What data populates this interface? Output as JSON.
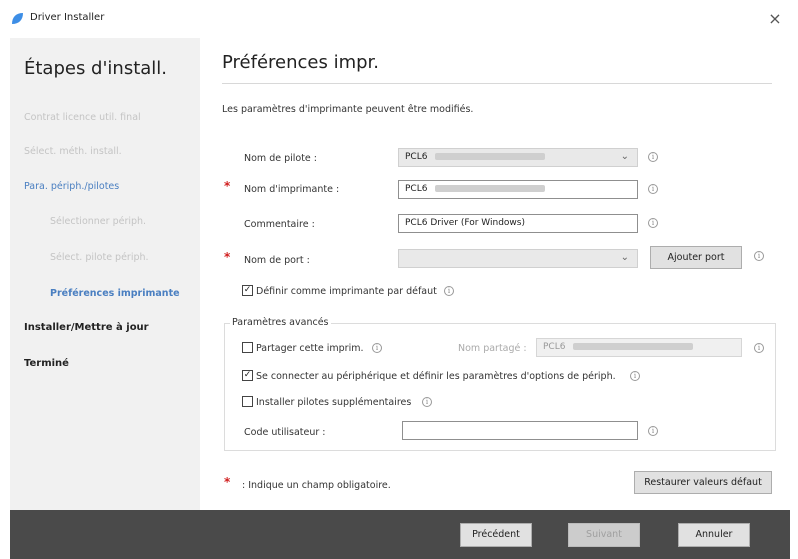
{
  "window": {
    "title": "Driver Installer",
    "close": "×"
  },
  "sidebar": {
    "heading": "Étapes d'install.",
    "steps": [
      {
        "label": "Contrat licence util. final",
        "state": "done"
      },
      {
        "label": "Sélect. méth. install.",
        "state": "done"
      },
      {
        "label": "Para. périph./pilotes",
        "state": "current-parent"
      },
      {
        "label": "Sélectionner périph.",
        "state": "done-sub"
      },
      {
        "label": "Sélect. pilote périph.",
        "state": "done-sub"
      },
      {
        "label": "Préférences imprimante",
        "state": "current"
      },
      {
        "label": "Installer/Mettre à jour",
        "state": "pending"
      },
      {
        "label": "Terminé",
        "state": "pending"
      }
    ]
  },
  "main": {
    "heading": "Préférences impr.",
    "description": "Les paramètres d'imprimante peuvent être modifiés.",
    "driver_name": {
      "label": "Nom de pilote :",
      "value": "PCL6"
    },
    "printer_name": {
      "label": "Nom d'imprimante :",
      "value": "PCL6"
    },
    "comment": {
      "label": "Commentaire :",
      "value": "PCL6 Driver (For Windows)"
    },
    "port_name": {
      "label": "Nom de port :",
      "value": "",
      "add_button": "Ajouter port"
    },
    "default_printer": {
      "label": "Définir comme imprimante par défaut",
      "checked": true
    },
    "advanced": {
      "title": "Paramètres avancés",
      "share": {
        "label": "Partager cette imprim.",
        "checked": false
      },
      "share_name": {
        "label": "Nom partagé :",
        "value": "PCL6"
      },
      "connect": {
        "label": "Se connecter au périphérique et définir les paramètres d'options de périph.",
        "checked": true
      },
      "extra_drivers": {
        "label": "Installer pilotes supplémentaires",
        "checked": false
      },
      "user_code": {
        "label": "Code utilisateur :",
        "value": ""
      }
    },
    "required_note": ": Indique un champ obligatoire.",
    "restore_button": "Restaurer valeurs défaut"
  },
  "footer": {
    "back": "Précédent",
    "next": "Suivant",
    "cancel": "Annuler"
  },
  "icons": {
    "info": "i",
    "check": "✓",
    "chevron": "⌄",
    "required": "*"
  },
  "colors": {
    "required": "#d12020",
    "accent": "#4a7fc1",
    "footer": "#4a4a4a"
  }
}
